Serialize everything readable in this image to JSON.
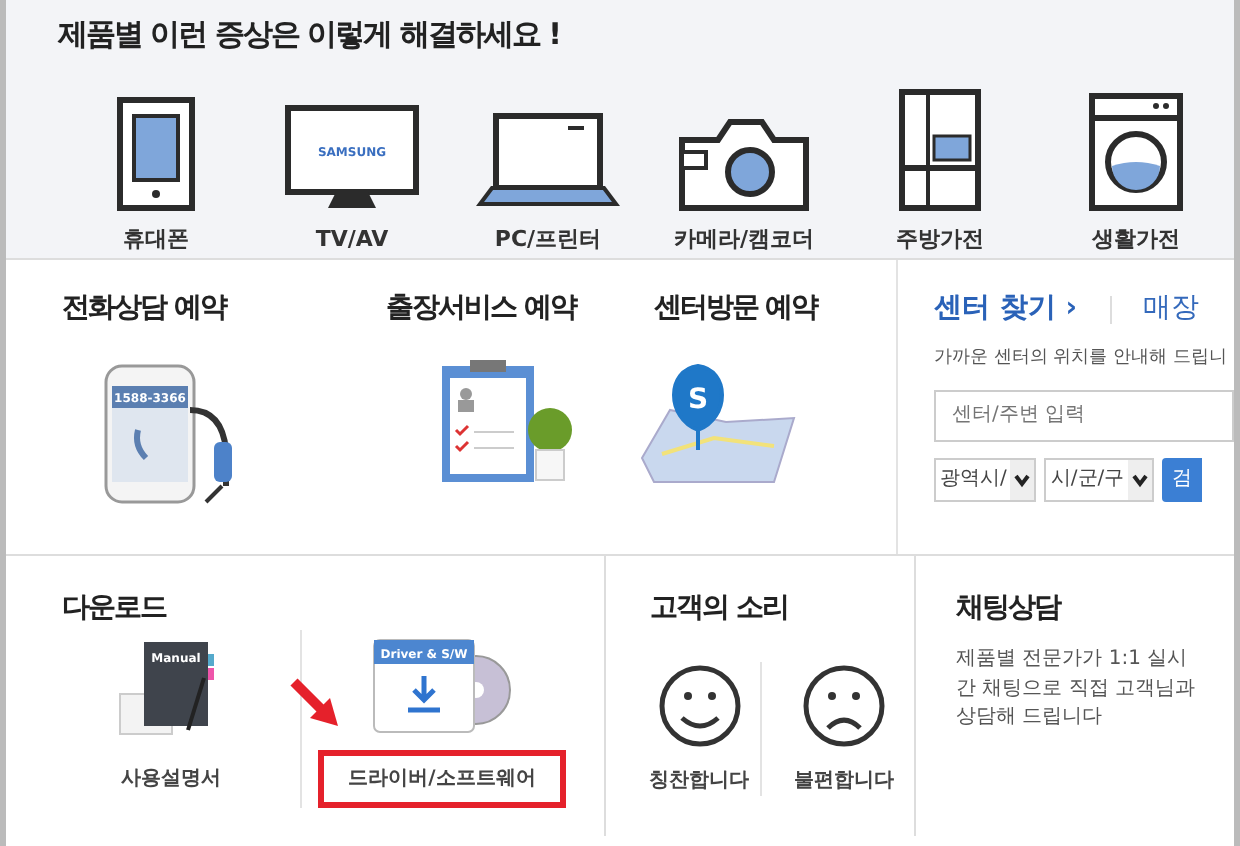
{
  "heading": "제품별 이런 증상은 이렇게 해결하세요 !",
  "products": [
    {
      "kind": "phone",
      "label": "휴대폰"
    },
    {
      "kind": "tv",
      "label": "TV/AV",
      "screen_text": "SAMSUNG"
    },
    {
      "kind": "laptop",
      "label": "PC/프린터"
    },
    {
      "kind": "camera",
      "label": "카메라/캠코더"
    },
    {
      "kind": "fridge",
      "label": "주방가전"
    },
    {
      "kind": "washer",
      "label": "생활가전"
    }
  ],
  "reservations": [
    {
      "kind": "call",
      "title": "전화상담 예약",
      "screen_text": "1588-3366"
    },
    {
      "kind": "clipboard",
      "title": "출장서비스 예약"
    },
    {
      "kind": "map",
      "title": "센터방문 예약",
      "pin_text": "S"
    }
  ],
  "center_finder": {
    "tabs": [
      {
        "label": "센터 찾기 ›",
        "selected": true
      },
      {
        "label": "매장",
        "selected": false
      }
    ],
    "description": "가까운 센터의 위치를 안내해 드립니",
    "search": {
      "placeholder": "센터/주변 입력"
    },
    "selects": [
      "광역시/",
      "시/군/구"
    ],
    "button": "검"
  },
  "download": {
    "title": "다운로드",
    "items": [
      {
        "kind": "manual",
        "cover_text": "Manual",
        "label": "사용설명서",
        "highlighted": false
      },
      {
        "kind": "driver",
        "cover_text": "Driver & S/W",
        "label": "드라이버/소프트웨어",
        "highlighted": true
      }
    ]
  },
  "voice": {
    "title": "고객의 소리",
    "items": [
      {
        "kind": "happy",
        "label": "칭찬합니다"
      },
      {
        "kind": "sad",
        "label": "불편합니다"
      }
    ]
  },
  "chat": {
    "title": "채팅상담",
    "text": "제품별 전문가가 1:1 실시간 채팅으로 직접 고객님과 상담해 드립니다"
  }
}
